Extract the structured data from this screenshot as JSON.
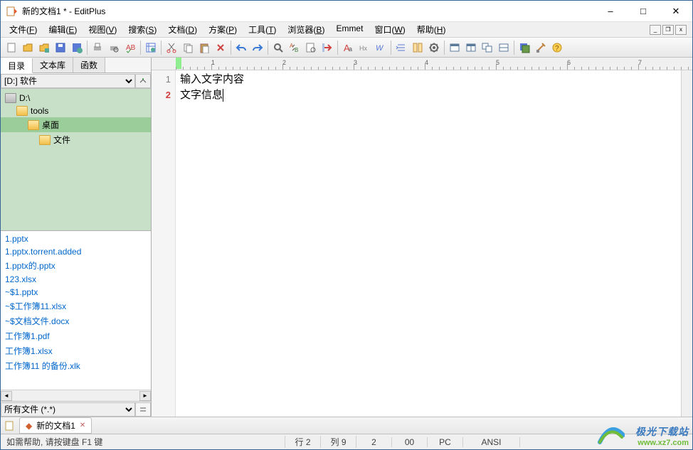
{
  "window": {
    "title": "新的文档1 * - EditPlus"
  },
  "menus": [
    {
      "label": "文件",
      "accel": "F"
    },
    {
      "label": "编辑",
      "accel": "E"
    },
    {
      "label": "视图",
      "accel": "V"
    },
    {
      "label": "搜索",
      "accel": "S"
    },
    {
      "label": "文档",
      "accel": "D"
    },
    {
      "label": "方案",
      "accel": "P"
    },
    {
      "label": "工具",
      "accel": "T"
    },
    {
      "label": "浏览器",
      "accel": "B"
    },
    {
      "label": "Emmet",
      "accel": ""
    },
    {
      "label": "窗口",
      "accel": "W"
    },
    {
      "label": "帮助",
      "accel": "H"
    }
  ],
  "sidebar": {
    "tabs": [
      "目录",
      "文本库",
      "函数"
    ],
    "active_tab": 0,
    "drive_selected": "[D:] 软件",
    "folders": [
      {
        "name": "D:\\",
        "depth": 0
      },
      {
        "name": "tools",
        "depth": 1
      },
      {
        "name": "桌面",
        "depth": 2
      },
      {
        "name": "文件",
        "depth": 3
      }
    ],
    "files": [
      "1.pptx",
      "1.pptx.torrent.added",
      "1.pptx的.pptx",
      "123.xlsx",
      "~$1.pptx",
      "~$工作簿11.xlsx",
      "~$文档文件.docx",
      "工作簿1.pdf",
      "工作簿1.xlsx",
      "工作簿11 的备份.xlk"
    ],
    "filter": "所有文件 (*.*)"
  },
  "editor": {
    "lines": [
      "输入文字内容",
      "文字信息"
    ],
    "current_line": 2,
    "ruler_max": 9
  },
  "doctabs": {
    "active": {
      "label": "新的文档1",
      "modified": true
    }
  },
  "status": {
    "hint": "如需帮助, 请按键盘 F1 键",
    "line": "行 2",
    "col": "列 9",
    "num": "2",
    "sel": "00",
    "mode": "PC",
    "encoding": "ANSI"
  },
  "watermark": {
    "name": "极光下载站",
    "url": "www.xz7.com"
  }
}
